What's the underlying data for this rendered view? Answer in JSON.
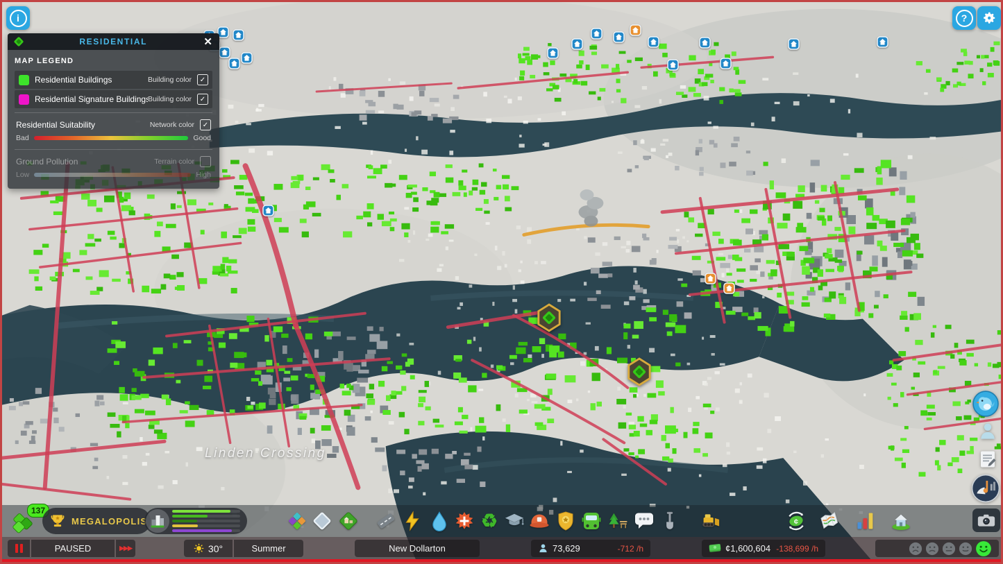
{
  "topbar": {
    "info_icon": "i",
    "help_icon": "?",
    "settings_icon": "gear",
    "accent_color": "#2ba7e2"
  },
  "icons": {
    "close": "✕",
    "check": "✓",
    "ffwd": "▶▶▶",
    "recycle": "♻",
    "note": "♪",
    "currency": "¢"
  },
  "legend_panel": {
    "title": "RESIDENTIAL",
    "title_color": "#49b8e8",
    "section_title": "MAP LEGEND",
    "items": [
      {
        "label": "Residential Buildings",
        "type_label": "Building color",
        "checked": true,
        "swatch_color": "#3de32a"
      },
      {
        "label": "Residential Signature Buildings",
        "type_label": "Building color",
        "checked": true,
        "swatch_color": "#ee14c8"
      }
    ],
    "gradient_items": [
      {
        "label": "Residential Suitability",
        "type_label": "Network color",
        "checked": true,
        "enabled": true,
        "low_label": "Bad",
        "high_label": "Good",
        "gradient": [
          "#d41f2c",
          "#e2642a",
          "#ecc23c",
          "#7fd02c",
          "#1fc93c"
        ]
      },
      {
        "label": "Ground Pollution",
        "type_label": "Terrain color",
        "checked": false,
        "enabled": false,
        "low_label": "Low",
        "high_label": "High",
        "gradient": [
          "#a6cbe4",
          "#d9cfc2",
          "#c8824e",
          "#a82a1e"
        ]
      }
    ]
  },
  "map": {
    "district_label": "Linden Crossing",
    "overlay_building_color": "#44d214",
    "signature_marker": "signature-hex-marker",
    "service_marker": "house-marker"
  },
  "progression": {
    "milestone_level": "137",
    "milestone_name": "MEGALOPOLIS"
  },
  "demand": {
    "bars": [
      {
        "name": "residential-low",
        "value": 86,
        "color": "#7de23c"
      },
      {
        "name": "residential-medium",
        "value": 52,
        "color": "#46b820"
      },
      {
        "name": "residential-high",
        "value": 37,
        "color": "#2e7e16"
      },
      {
        "name": "industrial",
        "value": 38,
        "color": "#e2c23e"
      },
      {
        "name": "office",
        "value": 88,
        "color": "#8c46d2"
      }
    ]
  },
  "toolbar": {
    "items": [
      "zones",
      "terrain",
      "areas",
      "roads",
      "electricity",
      "water-sewage",
      "healthcare",
      "garbage",
      "education",
      "fire-rescue",
      "police",
      "transportation",
      "parks-recreation",
      "communications",
      "terraforming",
      "bulldozer",
      "economy",
      "info-views",
      "statistics",
      "city-information",
      "photo-mode"
    ]
  },
  "side_panel_icons": [
    "chirper",
    "citizen-info",
    "journal",
    "radio"
  ],
  "statusbar": {
    "speed_state": "PAUSED",
    "weather": {
      "icon": "sun",
      "temperature": "30°",
      "season": "Summer"
    },
    "city_name": "New Dollarton",
    "population": {
      "icon": "citizen",
      "value": "73,629",
      "rate": "-712 /h",
      "rate_color": "#e85545"
    },
    "money": {
      "icon": "money-bill",
      "value": "¢1,600,604",
      "rate": "-138,699 /h",
      "rate_color": "#e85545"
    },
    "happiness": {
      "moods": [
        "sad",
        "unhappy",
        "neutral",
        "content",
        "happy"
      ],
      "selected": "happy",
      "selected_color": "#38e838"
    }
  }
}
